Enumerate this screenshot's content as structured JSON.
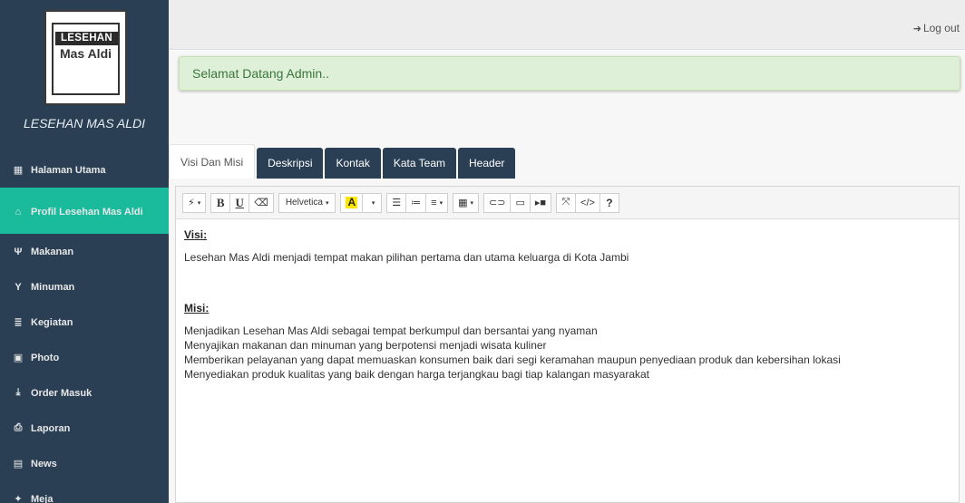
{
  "sidebar": {
    "logo": {
      "line1": "LESEHAN",
      "line2": "Mas Aldi"
    },
    "brand_title": "LESEHAN MAS ALDI",
    "items": [
      {
        "label": "Halaman Utama",
        "icon": "grid-icon",
        "glyph": "▦"
      },
      {
        "label": "Profil Lesehan Mas Aldi",
        "icon": "home-icon",
        "glyph": "⌂",
        "active": true
      },
      {
        "label": "Makanan",
        "icon": "cutlery-icon",
        "glyph": "Ψ"
      },
      {
        "label": "Minuman",
        "icon": "glass-icon",
        "glyph": "Y"
      },
      {
        "label": "Kegiatan",
        "icon": "list-icon",
        "glyph": "≣"
      },
      {
        "label": "Photo",
        "icon": "picture-icon",
        "glyph": "▣"
      },
      {
        "label": "Order Masuk",
        "icon": "download-icon",
        "glyph": "⤓"
      },
      {
        "label": "Laporan",
        "icon": "print-icon",
        "glyph": "⎙"
      },
      {
        "label": "News",
        "icon": "newspaper-icon",
        "glyph": "▤"
      },
      {
        "label": "Meja",
        "icon": "table-icon",
        "glyph": "✦"
      }
    ]
  },
  "topbar": {
    "logout_label": "Log out",
    "logout_icon": "logout-icon"
  },
  "alert": {
    "text": "Selamat Datang Admin.."
  },
  "tabs": [
    {
      "label": "Visi Dan Misi",
      "active": true
    },
    {
      "label": "Deskripsi"
    },
    {
      "label": "Kontak"
    },
    {
      "label": "Kata Team"
    },
    {
      "label": "Header"
    }
  ],
  "toolbar": {
    "magic_glyph": "⚡",
    "bold": "B",
    "underline": "U",
    "eraser_glyph": "⌫",
    "font_name": "Helvetica",
    "color_letter": "A",
    "ul_glyph": "☰",
    "ol_glyph": "≔",
    "align_glyph": "≡",
    "table_glyph": "▦",
    "link_glyph": "⊂⊃",
    "image_glyph": "▭",
    "video_glyph": "▸■",
    "fullscreen_glyph": "⤧",
    "code_glyph": "</>",
    "help": "?",
    "dropdown_caret": "▾"
  },
  "content": {
    "visi_heading": "Visi:",
    "visi_text": "Lesehan Mas Aldi menjadi tempat makan pilihan pertama dan utama keluarga di Kota Jambi",
    "misi_heading": "Misi:",
    "misi_lines": [
      "Menjadikan Lesehan Mas Aldi sebagai tempat berkumpul dan bersantai yang nyaman",
      "Menyajikan makanan dan minuman yang berpotensi menjadi wisata kuliner",
      "Memberikan pelayanan yang dapat memuaskan konsumen baik dari segi keramahan maupun penyediaan produk dan kebersihan lokasi",
      "Menyediakan produk kualitas yang baik dengan harga terjangkau bagi tiap kalangan masyarakat"
    ]
  }
}
